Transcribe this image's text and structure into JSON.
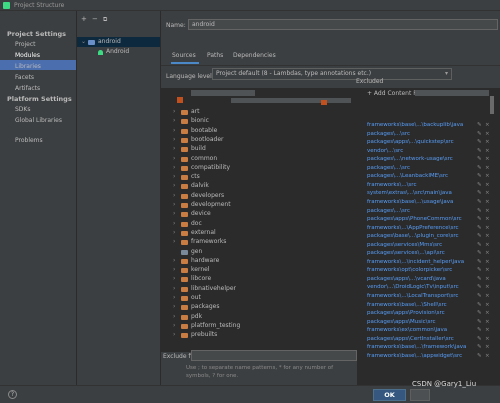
{
  "window": {
    "title": "Project Structure"
  },
  "nav": {
    "project_settings": "Project Settings",
    "project": "Project",
    "modules": "Modules",
    "libraries": "Libraries",
    "facets": "Facets",
    "artifacts": "Artifacts",
    "platform_settings": "Platform Settings",
    "sdks": "SDKs",
    "global_libraries": "Global Libraries",
    "problems": "Problems"
  },
  "modules": {
    "toolbar": {
      "add": "+",
      "remove": "−",
      "copy": "⧉"
    },
    "root": "android",
    "child": "Android"
  },
  "form": {
    "name_label": "Name:",
    "name_value": "android",
    "tabs": [
      "Sources",
      "Paths",
      "Dependencies"
    ],
    "language_label": "Language level:",
    "language_value": "Project default (8 - Lambdas, type annotations etc.)",
    "excluded_label": "Excluded",
    "add_content_root": "+ Add Content Root",
    "exclude_files_label": "Exclude files:",
    "exclude_hint": "Use ; to separate name patterns, * for any number of symbols, ? for one."
  },
  "folders": [
    "art",
    "bionic",
    "bootable",
    "bootloader",
    "build",
    "common",
    "compatibility",
    "cts",
    "dalvik",
    "developers",
    "development",
    "device",
    "doc",
    "external",
    "frameworks",
    "gen",
    "hardware",
    "kernel",
    "libcore",
    "libnativehelper",
    "out",
    "packages",
    "pdk",
    "platform_testing",
    "prebuilts"
  ],
  "source_paths": [
    "frameworks\\base\\...\\backuplib\\java",
    "packages\\...\\src",
    "packages\\apps\\...\\quickstep\\src",
    "vendor\\...\\src",
    "packages\\...\\network-usage\\src",
    "packages\\...\\src",
    "packages\\...\\LeanbackIME\\src",
    "frameworks\\...\\src",
    "system\\extras\\...\\src\\main\\java",
    "frameworks\\base\\...\\usage\\java",
    "packages\\...\\src",
    "packages\\apps\\PhoneCommon\\src",
    "frameworks\\...\\AppPreference\\src",
    "packages\\base\\...\\plugin_core\\src",
    "packages\\services\\Mms\\src",
    "packages\\services\\...\\api\\src",
    "frameworks\\...\\incident_helper\\java",
    "frameworks\\opt\\colorpicker\\src",
    "packages\\apps\\...\\vcard\\java",
    "vendor\\...\\DroidLogic\\Tv\\input\\src",
    "frameworks\\...\\LocalTransport\\src",
    "frameworks\\base\\...\\Shell\\src",
    "packages\\apps\\Provision\\src",
    "packages\\apps\\Music\\src",
    "frameworks\\ex\\common\\java",
    "packages\\apps\\CertInstaller\\src",
    "frameworks\\base\\...\\framework\\java",
    "frameworks\\base\\...\\appwidget\\src"
  ],
  "footer": {
    "help": "?",
    "ok": "OK",
    "watermark": "CSDN @Gary1_Liu"
  }
}
